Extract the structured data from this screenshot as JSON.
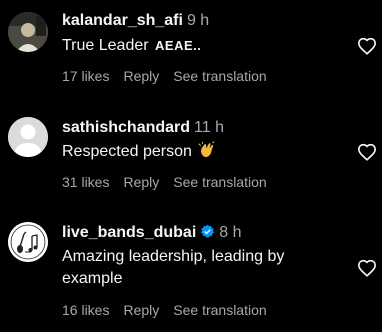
{
  "comments": [
    {
      "username": "kalandar_sh_afi",
      "time": "9 h",
      "text": "True Leader",
      "text_suffix": "AEAE..",
      "likes": "17 likes",
      "reply": "Reply",
      "translate": "See translation"
    },
    {
      "username": "sathishchandard",
      "time": "11 h",
      "text": "Respected person",
      "likes": "31 likes",
      "reply": "Reply",
      "translate": "See translation"
    },
    {
      "username": "live_bands_dubai",
      "time": "8 h",
      "text": "Amazing leadership, leading by example",
      "likes": "16 likes",
      "reply": "Reply",
      "translate": "See translation"
    }
  ],
  "icons": {
    "like": "heart-outline-icon",
    "verified": "verified-badge-icon",
    "emoji": "clapping-hands-emoji"
  },
  "colors": {
    "background": "#000000",
    "primary_text": "#f5f5f5",
    "secondary_text": "#a8a8a8",
    "verified_blue": "#0095f6"
  }
}
